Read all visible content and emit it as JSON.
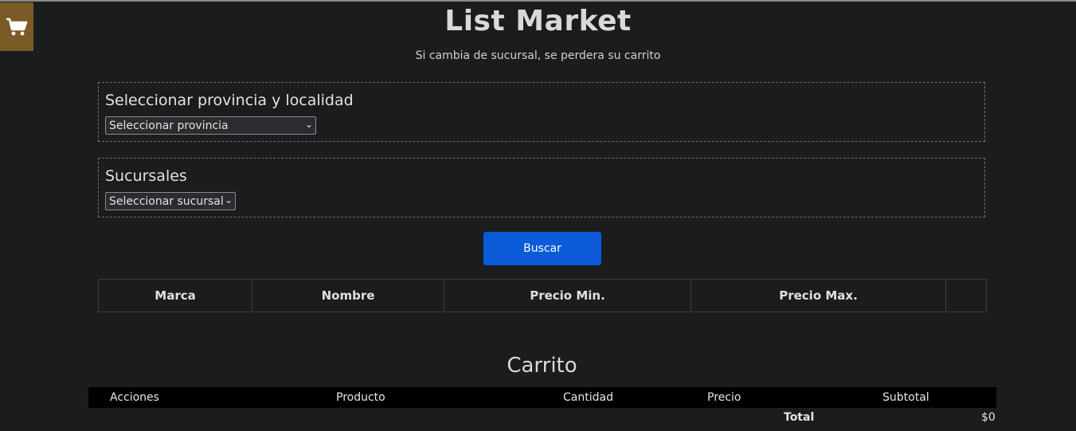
{
  "header": {
    "title": "List Market",
    "subtitle": "Si cambia de sucursal, se perdera su carrito",
    "cart_icon": "shopping-cart-icon",
    "cart_toggle_color": "#7a5a26"
  },
  "location": {
    "legend": "Seleccionar provincia y localidad",
    "province_select": "Seleccionar provincia"
  },
  "branches": {
    "legend": "Sucursales",
    "branch_select": "Seleccionar sucursal"
  },
  "search": {
    "button_label": "Buscar",
    "button_color": "#0b5ad8"
  },
  "products_table": {
    "columns": [
      "Marca",
      "Nombre",
      "Precio Min.",
      "Precio Max.",
      ""
    ]
  },
  "cart": {
    "title": "Carrito",
    "columns": [
      "Acciones",
      "Producto",
      "Cantidad",
      "Precio",
      "Subtotal"
    ],
    "total_label": "Total",
    "total_value": "$0"
  }
}
